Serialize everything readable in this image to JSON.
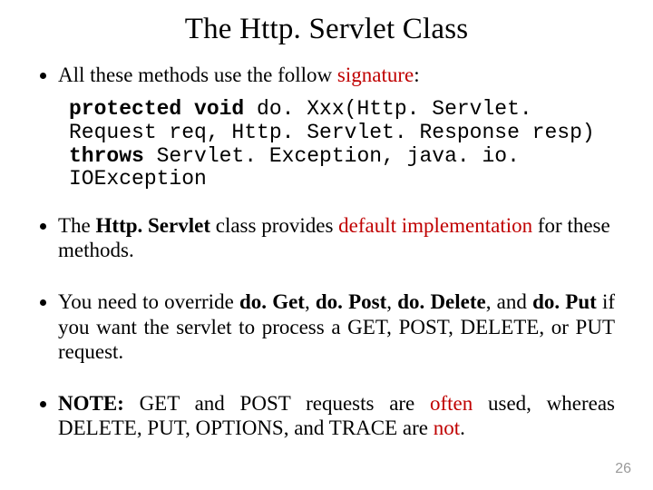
{
  "title": "The Http. Servlet Class",
  "bullets": {
    "b1_pre": "All these methods use the follow ",
    "b1_red": "signature",
    "b1_post": ":",
    "code_kw1": "protected void",
    "code_seg1": " do. Xxx(Http. Servlet. Request req, Http. Servlet. Response resp) ",
    "code_kw2": "throws",
    "code_seg2": " Servlet. Exception, java. io. IOException",
    "b2_pre": "The ",
    "b2_b": "Http. Servlet",
    "b2_mid": " class provides ",
    "b2_red": "default implementation",
    "b2_post": " for these methods.",
    "b3_pre": "You need to override ",
    "b3_b1": "do. Get",
    "b3_s1": ", ",
    "b3_b2": "do. Post",
    "b3_s2": ", ",
    "b3_b3": "do. Delete",
    "b3_s3": ", and ",
    "b3_b4": "do. Put",
    "b3_post": " if you want the servlet to process a GET, POST, DELETE, or PUT request.",
    "b4_b": "NOTE:",
    "b4_s1": " GET and POST requests are ",
    "b4_r1": "often",
    "b4_s2": " used, whereas DELETE, PUT, OPTIONS, and TRACE are ",
    "b4_r2": "not",
    "b4_s3": "."
  },
  "page_number": "26"
}
